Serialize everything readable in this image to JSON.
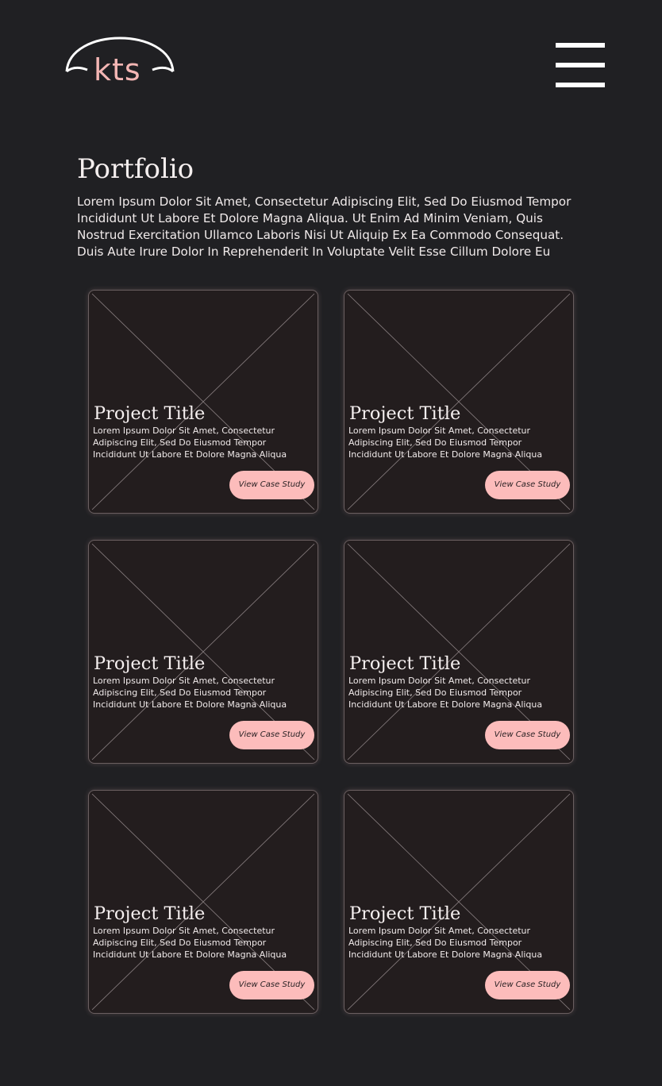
{
  "header": {
    "logo_text": "kts",
    "logo_icon": "umbrella-arc",
    "menu_icon": "hamburger-menu"
  },
  "main": {
    "title": "Portfolio",
    "intro": "Lorem Ipsum Dolor Sit Amet, Consectetur Adipiscing Elit, Sed Do Eiusmod Tempor Incididunt Ut Labore Et Dolore Magna Aliqua. Ut Enim Ad Minim Veniam, Quis Nostrud Exercitation Ullamco Laboris Nisi Ut Aliquip Ex Ea Commodo Consequat. Duis Aute Irure Dolor In Reprehenderit In Voluptate Velit Esse Cillum Dolore Eu"
  },
  "projects": [
    {
      "title": "Project Title",
      "description": "Lorem Ipsum Dolor Sit Amet, Consectetur Adipiscing Elit, Sed Do Eiusmod Tempor Incididunt Ut Labore Et Dolore Magna Aliqua",
      "button_label": "View Case Study"
    },
    {
      "title": "Project Title",
      "description": "Lorem Ipsum Dolor Sit Amet, Consectetur Adipiscing Elit, Sed Do Eiusmod Tempor Incididunt Ut Labore Et Dolore Magna Aliqua",
      "button_label": "View Case Study"
    },
    {
      "title": "Project Title",
      "description": "Lorem Ipsum Dolor Sit Amet, Consectetur Adipiscing Elit, Sed Do Eiusmod Tempor Incididunt Ut Labore Et Dolore Magna Aliqua",
      "button_label": "View Case Study"
    },
    {
      "title": "Project Title",
      "description": "Lorem Ipsum Dolor Sit Amet, Consectetur Adipiscing Elit, Sed Do Eiusmod Tempor Incididunt Ut Labore Et Dolore Magna Aliqua",
      "button_label": "View Case Study"
    },
    {
      "title": "Project Title",
      "description": "Lorem Ipsum Dolor Sit Amet, Consectetur Adipiscing Elit, Sed Do Eiusmod Tempor Incididunt Ut Labore Et Dolore Magna Aliqua",
      "button_label": "View Case Study"
    },
    {
      "title": "Project Title",
      "description": "Lorem Ipsum Dolor Sit Amet, Consectetur Adipiscing Elit, Sed Do Eiusmod Tempor Incididunt Ut Labore Et Dolore Magna Aliqua",
      "button_label": "View Case Study"
    }
  ],
  "colors": {
    "background": "#202023",
    "card_background": "#231d1e",
    "accent": "#fcbcbb",
    "text": "#f3eeee"
  }
}
